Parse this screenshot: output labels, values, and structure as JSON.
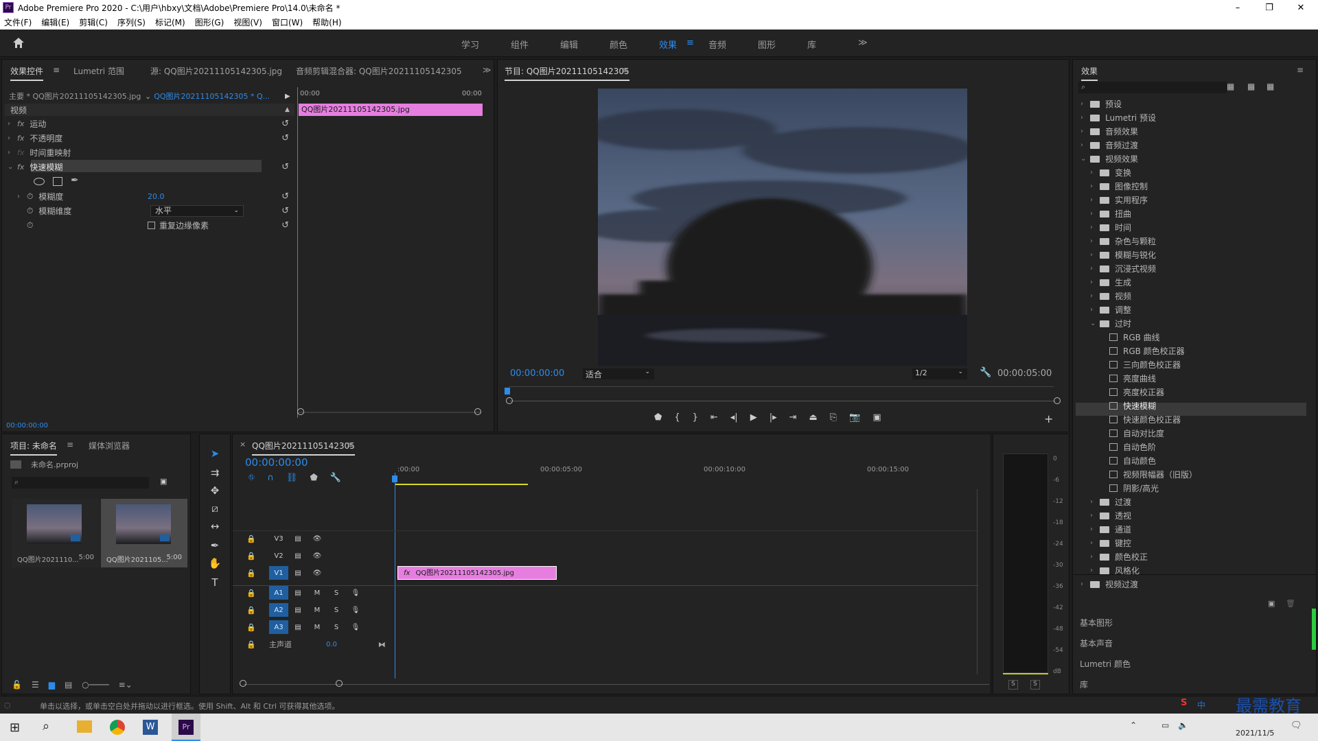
{
  "window": {
    "title": "Adobe Premiere Pro 2020 - C:\\用户\\hbxy\\文档\\Adobe\\Premiere Pro\\14.0\\未命名 *",
    "app_icon": "Pr",
    "minimize": "–",
    "maximize": "❐",
    "close": "✕"
  },
  "menu": [
    "文件(F)",
    "编辑(E)",
    "剪辑(C)",
    "序列(S)",
    "标记(M)",
    "图形(G)",
    "视图(V)",
    "窗口(W)",
    "帮助(H)"
  ],
  "workspaces": [
    "学习",
    "组件",
    "编辑",
    "颜色",
    "效果",
    "音频",
    "图形",
    "库"
  ],
  "workspace_active": "效果",
  "workspace_more": "≫",
  "effect_controls": {
    "tabs": [
      "效果控件",
      "Lumetri 范围",
      "源: QQ图片20211105142305.jpg",
      "音频剪辑混合器: QQ图片20211105142305"
    ],
    "master": "主要 * QQ图片20211105142305.jpg",
    "sequence": "QQ图片20211105142305 * Q...",
    "section_video": "视频",
    "items": [
      "运动",
      "不透明度",
      "时间重映射",
      "快速模糊"
    ],
    "blur_amount_label": "模糊度",
    "blur_amount": "20.0",
    "blur_dim_label": "模糊维度",
    "blur_dim": "水平",
    "repeat_edge": "重复边缘像素",
    "timecode": "00:00:00:00",
    "mini_ruler_start": "00:00",
    "mini_ruler_end": "00:00",
    "clip_name": "QQ图片20211105142305.jpg"
  },
  "program": {
    "title": "节目: QQ图片20211105142305",
    "timecode": "00:00:00:00",
    "fit": "适合",
    "resolution": "1/2",
    "duration": "00:00:05:00"
  },
  "project": {
    "tabs": [
      "项目: 未命名",
      "媒体浏览器"
    ],
    "file": "未命名.prproj",
    "items": [
      {
        "name": "QQ图片2021110...",
        "dur": "5:00"
      },
      {
        "name": "QQ图片2021105...",
        "dur": "5:00"
      }
    ]
  },
  "timeline": {
    "seq_name": "QQ图片20211105142305",
    "timecode": "00:00:00:00",
    "ruler": [
      ":00:00",
      "00:00:05:00",
      "00:00:10:00",
      "00:00:15:00"
    ],
    "video_tracks": [
      "V3",
      "V2",
      "V1"
    ],
    "audio_tracks": [
      "A1",
      "A2",
      "A3"
    ],
    "master_label": "主声道",
    "master_value": "0.0",
    "clip": "QQ图片20211105142305.jpg",
    "m": "M",
    "s": "S"
  },
  "meter": {
    "labels": [
      "0",
      "-6",
      "-12",
      "-18",
      "-24",
      "-30",
      "-36",
      "-42",
      "-48",
      "-54",
      "dB"
    ],
    "solo": [
      "S",
      "S"
    ]
  },
  "effects": {
    "title": "效果",
    "tree": [
      {
        "label": "预设",
        "depth": 0,
        "type": "folder"
      },
      {
        "label": "Lumetri 预设",
        "depth": 0,
        "type": "folder"
      },
      {
        "label": "音频效果",
        "depth": 0,
        "type": "folder"
      },
      {
        "label": "音频过渡",
        "depth": 0,
        "type": "folder"
      },
      {
        "label": "视频效果",
        "depth": 0,
        "type": "folder",
        "open": true
      },
      {
        "label": "变换",
        "depth": 1,
        "type": "folder"
      },
      {
        "label": "图像控制",
        "depth": 1,
        "type": "folder"
      },
      {
        "label": "实用程序",
        "depth": 1,
        "type": "folder"
      },
      {
        "label": "扭曲",
        "depth": 1,
        "type": "folder"
      },
      {
        "label": "时间",
        "depth": 1,
        "type": "folder"
      },
      {
        "label": "杂色与颗粒",
        "depth": 1,
        "type": "folder"
      },
      {
        "label": "模糊与锐化",
        "depth": 1,
        "type": "folder"
      },
      {
        "label": "沉浸式视频",
        "depth": 1,
        "type": "folder"
      },
      {
        "label": "生成",
        "depth": 1,
        "type": "folder"
      },
      {
        "label": "视频",
        "depth": 1,
        "type": "folder"
      },
      {
        "label": "调整",
        "depth": 1,
        "type": "folder"
      },
      {
        "label": "过时",
        "depth": 1,
        "type": "folder",
        "open": true
      },
      {
        "label": "RGB 曲线",
        "depth": 2,
        "type": "fx"
      },
      {
        "label": "RGB 颜色校正器",
        "depth": 2,
        "type": "fx"
      },
      {
        "label": "三向颜色校正器",
        "depth": 2,
        "type": "fx"
      },
      {
        "label": "亮度曲线",
        "depth": 2,
        "type": "fx"
      },
      {
        "label": "亮度校正器",
        "depth": 2,
        "type": "fx"
      },
      {
        "label": "快速模糊",
        "depth": 2,
        "type": "fx",
        "selected": true
      },
      {
        "label": "快速颜色校正器",
        "depth": 2,
        "type": "fx"
      },
      {
        "label": "自动对比度",
        "depth": 2,
        "type": "fx"
      },
      {
        "label": "自动色阶",
        "depth": 2,
        "type": "fx"
      },
      {
        "label": "自动颜色",
        "depth": 2,
        "type": "fx"
      },
      {
        "label": "视频限幅器（旧版）",
        "depth": 2,
        "type": "fx"
      },
      {
        "label": "阴影/高光",
        "depth": 2,
        "type": "fx"
      },
      {
        "label": "过渡",
        "depth": 1,
        "type": "folder"
      },
      {
        "label": "透视",
        "depth": 1,
        "type": "folder"
      },
      {
        "label": "通道",
        "depth": 1,
        "type": "folder"
      },
      {
        "label": "键控",
        "depth": 1,
        "type": "folder"
      },
      {
        "label": "颜色校正",
        "depth": 1,
        "type": "folder"
      },
      {
        "label": "风格化",
        "depth": 1,
        "type": "folder"
      },
      {
        "label": "视频过渡",
        "depth": 0,
        "type": "folder"
      }
    ],
    "sections": [
      "基本图形",
      "基本声音",
      "Lumetri 颜色",
      "库"
    ]
  },
  "status": "单击以选择，或单击空白处并拖动以进行框选。使用 Shift、Alt 和 Ctrl 可获得其他选项。",
  "tray": {
    "date": "2021/11/5",
    "watermark": "最需教育",
    "ime": "中"
  },
  "colors": {
    "accent": "#2d8ceb",
    "clip": "#e67ee0",
    "panel": "#232323"
  }
}
